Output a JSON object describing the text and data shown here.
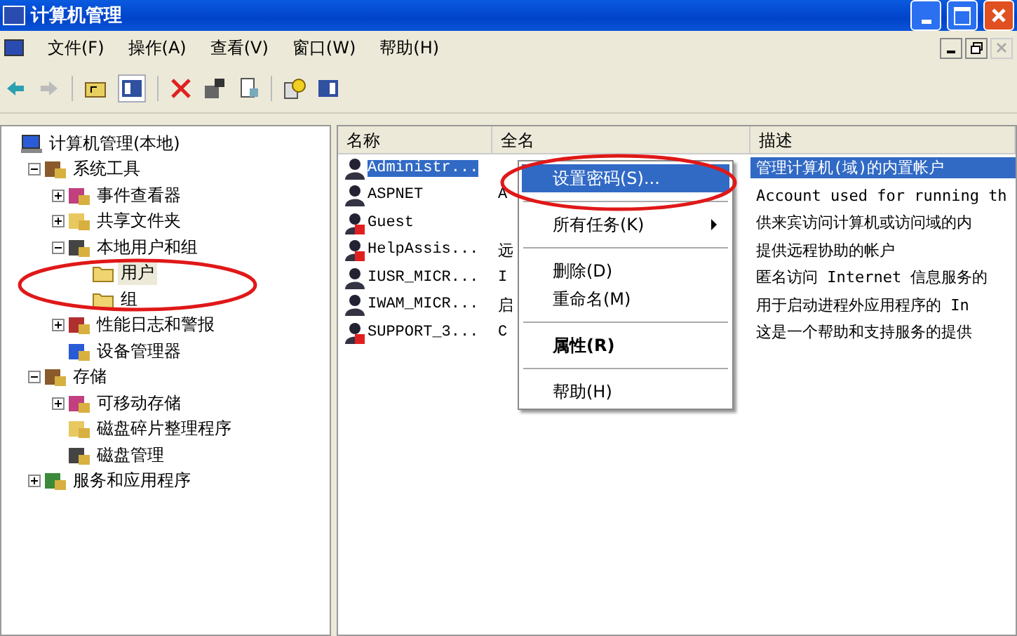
{
  "window": {
    "title": "计算机管理"
  },
  "menu_bar": [
    "文件(F)",
    "操作(A)",
    "查看(V)",
    "窗口(W)",
    "帮助(H)"
  ],
  "tree": [
    {
      "label": "计算机管理(本地)",
      "selected": false,
      "children": [
        {
          "label": "系统工具",
          "expanded": true,
          "selected": false,
          "children": [
            {
              "label": "事件查看器",
              "expanded": false,
              "selected": false
            },
            {
              "label": "共享文件夹",
              "expanded": false,
              "selected": false
            },
            {
              "label": "本地用户和组",
              "expanded": true,
              "selected": false,
              "children": [
                {
                  "label": "用户",
                  "selected": true
                },
                {
                  "label": "组",
                  "selected": false
                }
              ]
            },
            {
              "label": "性能日志和警报",
              "expanded": false,
              "selected": false
            },
            {
              "label": "设备管理器",
              "selected": false
            }
          ]
        },
        {
          "label": "存储",
          "expanded": true,
          "selected": false,
          "children": [
            {
              "label": "可移动存储",
              "expanded": false,
              "selected": false
            },
            {
              "label": "磁盘碎片整理程序",
              "selected": false
            },
            {
              "label": "磁盘管理",
              "selected": false
            }
          ]
        },
        {
          "label": "服务和应用程序",
          "expanded": false,
          "selected": false
        }
      ]
    }
  ],
  "table": {
    "columns": [
      "名称",
      "全名",
      "描述"
    ],
    "rows": [
      {
        "name": "Administr...",
        "full_name": "",
        "description": "管理计算机(域)的内置帐户",
        "disabled": false,
        "selected": true
      },
      {
        "name": "ASPNET",
        "full_name": "A",
        "description": "Account used for running th",
        "disabled": false,
        "selected": false
      },
      {
        "name": "Guest",
        "full_name": "",
        "description": "供来宾访问计算机或访问域的内",
        "disabled": true,
        "selected": false
      },
      {
        "name": "HelpAssis...",
        "full_name": "远",
        "description": "提供远程协助的帐户",
        "disabled": true,
        "selected": false
      },
      {
        "name": "IUSR_MICR...",
        "full_name": "I",
        "description": "匿名访问 Internet 信息服务的",
        "disabled": false,
        "selected": false
      },
      {
        "name": "IWAM_MICR...",
        "full_name": "启",
        "description": "用于启动进程外应用程序的 In",
        "disabled": false,
        "selected": false
      },
      {
        "name": "SUPPORT_3...",
        "full_name": "C",
        "description": "这是一个帮助和支持服务的提供",
        "disabled": true,
        "selected": false
      }
    ]
  },
  "context_menu": [
    {
      "kind": "item",
      "label": "设置密码(S)...",
      "selected": true,
      "bold": false,
      "submenu": false
    },
    {
      "kind": "separator"
    },
    {
      "kind": "item",
      "label": "所有任务(K)",
      "selected": false,
      "bold": false,
      "submenu": true
    },
    {
      "kind": "separator"
    },
    {
      "kind": "item",
      "label": "删除(D)",
      "selected": false,
      "bold": false,
      "submenu": false
    },
    {
      "kind": "item",
      "label": "重命名(M)",
      "selected": false,
      "bold": false,
      "submenu": false
    },
    {
      "kind": "separator"
    },
    {
      "kind": "item",
      "label": "属性(R)",
      "selected": false,
      "bold": true,
      "submenu": false
    },
    {
      "kind": "separator"
    },
    {
      "kind": "item",
      "label": "帮助(H)",
      "selected": false,
      "bold": false,
      "submenu": false
    }
  ]
}
